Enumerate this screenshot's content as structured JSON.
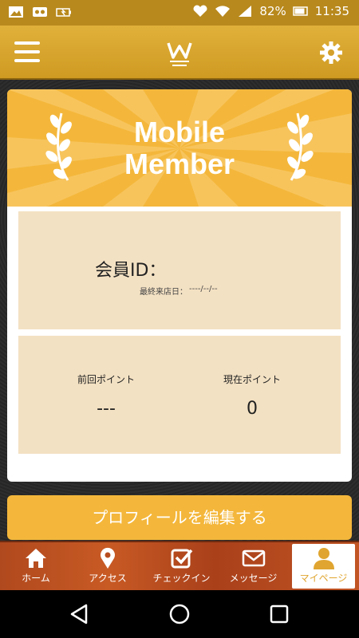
{
  "status_bar": {
    "battery": "82%",
    "time": "11:35"
  },
  "banner": {
    "title_line1": "Mobile",
    "title_line2": "Member"
  },
  "member": {
    "id_label": "会員ID：",
    "last_visit_label": "最終来店日：",
    "last_visit_value": "----/--/--"
  },
  "points": {
    "previous_label": "前回ポイント",
    "previous_value": "---",
    "current_label": "現在ポイント",
    "current_value": "0"
  },
  "edit_profile_label": "プロフィールを編集する",
  "nav": {
    "home": "ホーム",
    "access": "アクセス",
    "checkin": "チェックイン",
    "message": "メッセージ",
    "mypage": "マイページ"
  },
  "colors": {
    "accent": "#f4b73b",
    "header": "#d9a530",
    "panel": "#f3e1c3",
    "nav_wood": "#b84e20"
  },
  "icons": [
    "menu-icon",
    "logo-icon",
    "gear-icon",
    "home-icon",
    "location-pin-icon",
    "checkbox-icon",
    "envelope-icon",
    "person-icon",
    "back-icon",
    "home-circle-icon",
    "recents-icon"
  ]
}
